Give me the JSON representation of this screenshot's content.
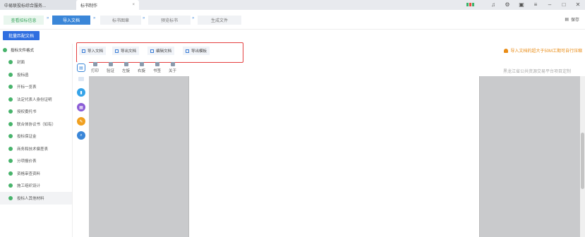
{
  "titlebar": {
    "tabs": [
      {
        "label": "中易联投标综合服务..."
      },
      {
        "label": "标书制作"
      }
    ],
    "close_glyph": "×",
    "controls": [
      "bell-icon",
      "gear-icon",
      "screen-icon",
      "menu-icon",
      "minimize-icon",
      "maximize-icon",
      "close-icon"
    ]
  },
  "steps": {
    "items": [
      {
        "label": "查看招标信息",
        "state": "done"
      },
      {
        "label": "导入文档",
        "state": "current"
      },
      {
        "label": "标书图章",
        "state": "todo"
      },
      {
        "label": "预览标书",
        "state": "todo"
      },
      {
        "label": "生成文件",
        "state": "todo"
      }
    ],
    "separator": "»",
    "save_label": "保存"
  },
  "batch_label": "批量匹配文档",
  "sidebar": {
    "header": "投标文件格式",
    "items": [
      "封面",
      "投标函",
      "开标一览表",
      "法定代表人身份证明",
      "授权委托书",
      "联合体协议书（如有）",
      "投标保证金",
      "商务和技术偏差表",
      "分项报价表",
      "资格审查资料",
      "施工组织设计",
      "投标人其他材料"
    ]
  },
  "toolbar": {
    "import_label": "导入文档",
    "export_label": "导出文档",
    "edit_label": "编辑文档",
    "template_label": "导出模板",
    "warning": "导入文档的超大于50M工期可自行压缩"
  },
  "viewer": {
    "tools": [
      "打印",
      "验证",
      "左旋",
      "右旋",
      "书签",
      "关于"
    ],
    "platform": "黑龙江省公共资源交易平台项目定制"
  },
  "colors": {
    "accent": "#3a86d8",
    "success": "#47b36b",
    "warning": "#e98c16",
    "highlight": "#e43f3f"
  }
}
